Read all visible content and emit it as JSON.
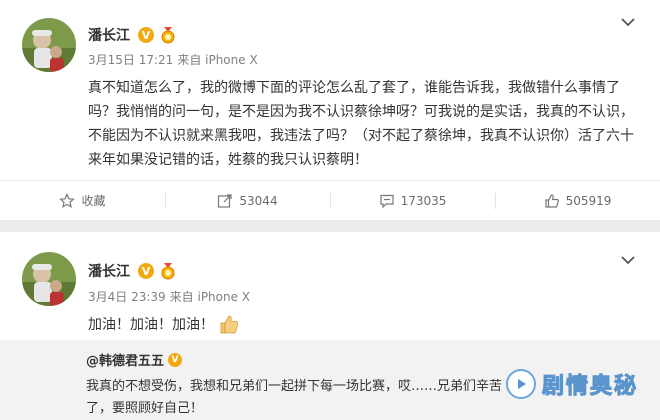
{
  "post1": {
    "author": "潘长江",
    "verified_badge": "V",
    "date": "3月15日 17:21",
    "source": "来自 iPhone X",
    "text": "真不知道怎么了，我的微博下面的评论怎么乱了套了，谁能告诉我，我做错什么事情了吗？我悄悄的问一句，是不是因为我不认识蔡徐坤呀？可我说的是实话，我真的不认识，不能因为不认识就来黑我吧，我违法了吗？（对不起了蔡徐坤，我真不认识你）活了六十来年如果没记错的话，姓蔡的我只认识蔡明！",
    "actions": {
      "favorite": "收藏",
      "repost": "53044",
      "comment": "173035",
      "like": "505919"
    }
  },
  "post2": {
    "author": "潘长江",
    "verified_badge": "V",
    "date": "3月4日 23:39",
    "source": "来自 iPhone X",
    "text": "加油！加油！加油！",
    "repost": {
      "author": "@韩德君五五",
      "text": "我真的不想受伤，我想和兄弟们一起拼下每一场比赛，哎……兄弟们辛苦了，要照顾好自己！"
    }
  },
  "watermark": {
    "text": "剧情奥秘",
    "icon": "play-circle-icon"
  },
  "colors": {
    "badge": "#f2a90f",
    "text": "#333333",
    "meta": "#808080",
    "repost_bg": "#f2f2f2"
  }
}
